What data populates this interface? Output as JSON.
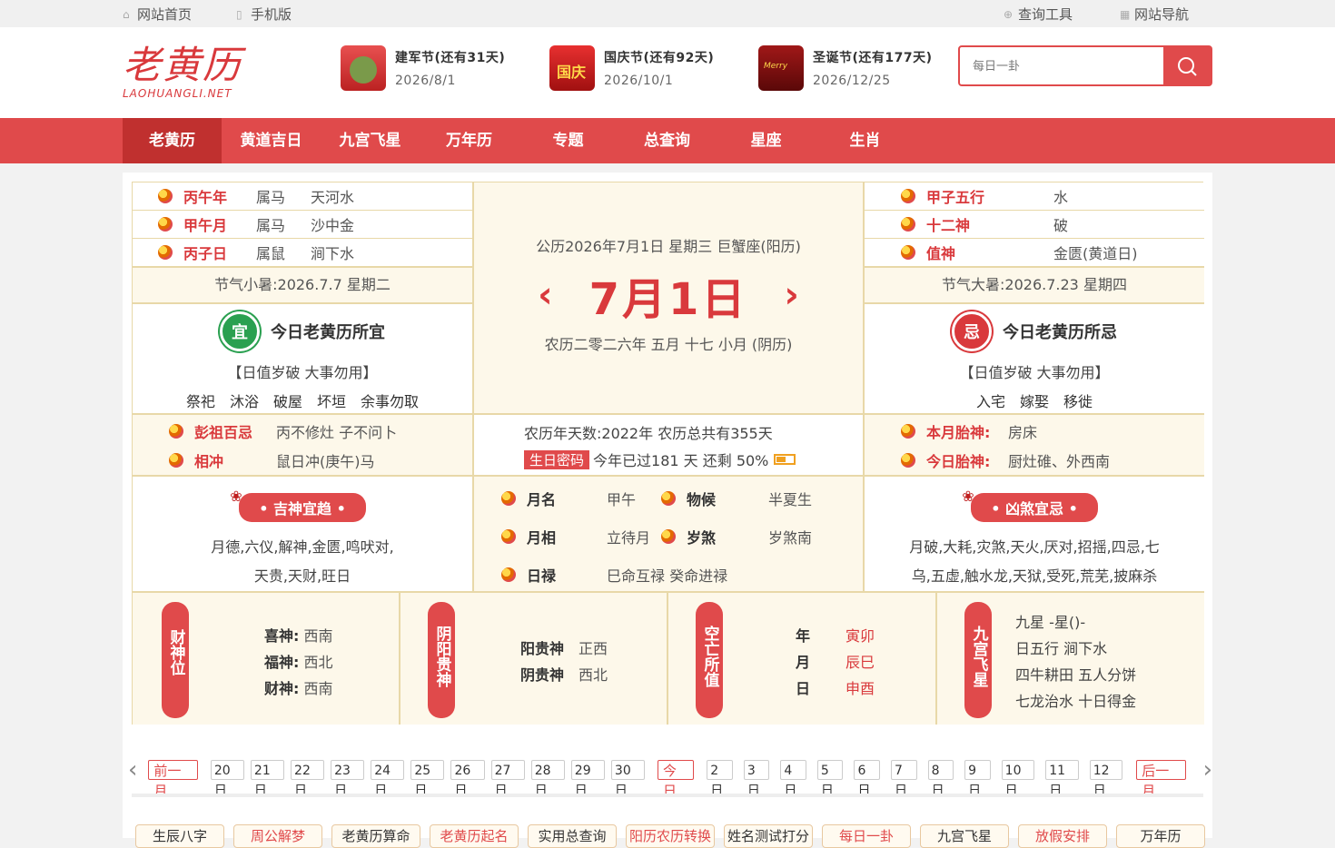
{
  "topbar": {
    "home": "网站首页",
    "mobile": "手机版",
    "tools": "查询工具",
    "nav": "网站导航"
  },
  "logo": {
    "cn": "老黄历",
    "en": "LAOHUANGLI.NET"
  },
  "festivals": [
    {
      "name": "建军节(还有31天)",
      "date": "2026/8/1"
    },
    {
      "name": "国庆节(还有92天)",
      "date": "2026/10/1"
    },
    {
      "name": "圣诞节(还有177天)",
      "date": "2026/12/25"
    }
  ],
  "search": {
    "placeholder": "每日一卦"
  },
  "nav": [
    "老黄历",
    "黄道吉日",
    "九宫飞星",
    "万年历",
    "专题",
    "总查询",
    "星座",
    "生肖"
  ],
  "left_rows": [
    {
      "k": "丙午年",
      "a": "属马",
      "b": "天河水"
    },
    {
      "k": "甲午月",
      "a": "属马",
      "b": "沙中金"
    },
    {
      "k": "丙子日",
      "a": "属鼠",
      "b": "涧下水"
    }
  ],
  "jieqi_left": "节气小暑:2026.7.7 星期二",
  "center": {
    "gongli": "公历2026年7月1日 星期三 巨蟹座(阳历)",
    "big": "7月1日",
    "nongli": "农历二零二六年 五月 十七 小月 (阴历)"
  },
  "right_rows": [
    {
      "k": "甲子五行",
      "v": "水"
    },
    {
      "k": "十二神",
      "v": "破"
    },
    {
      "k": "值神",
      "v": "金匮(黄道日)"
    }
  ],
  "jieqi_right": "节气大暑:2026.7.23 星期四",
  "yi": {
    "badge": "宜",
    "title": "今日老黄历所宜",
    "note": "【日值岁破 大事勿用】",
    "items": "祭祀　沐浴　破屋　坏垣　余事勿取"
  },
  "ji": {
    "badge": "忌",
    "title": "今日老黄历所忌",
    "note": "【日值岁破 大事勿用】",
    "items": "入宅　嫁娶　移徙"
  },
  "pengzu": {
    "k1": "彭祖百忌",
    "v1": "丙不修灶 子不问卜",
    "k2": "相冲",
    "v2": "鼠日冲(庚午)马"
  },
  "days": {
    "line1": "农历年天数:2022年 农历总共有355天",
    "tag": "生日密码",
    "line2": "今年已过181 天 还剩 50%"
  },
  "taishen": {
    "k1": "本月胎神:",
    "v1": "房床",
    "k2": "今日胎神:",
    "v2": "厨灶碓、外西南"
  },
  "jishen": {
    "ribbon": "吉神宜趋",
    "text1": "月德,六仪,解神,金匮,鸣吠对,",
    "text2": "天贵,天财,旺日"
  },
  "mid": {
    "k1": "月名",
    "v1": "甲午",
    "k2": "物候",
    "v2": "半夏生",
    "k3": "月相",
    "v3": "立待月",
    "k4": "岁煞",
    "v4": "岁煞南",
    "k5": "日禄",
    "v5": "巳命互禄 癸命进禄"
  },
  "xiongsha": {
    "ribbon": "凶煞宜忌",
    "text1": "月破,大耗,灾煞,天火,厌对,招摇,四忌,七",
    "text2": "乌,五虚,触水龙,天狱,受死,荒芜,披麻杀"
  },
  "caishen": {
    "tag": "财神位",
    "k1": "喜神:",
    "v1": "西南",
    "k2": "福神:",
    "v2": "西北",
    "k3": "财神:",
    "v3": "西南"
  },
  "guishen": {
    "tag": "阴阳贵神",
    "k1": "阳贵神",
    "v1": "正西",
    "k2": "阴贵神",
    "v2": "西北"
  },
  "kongwang": {
    "tag": "空亡所值",
    "k1": "年",
    "v1": "寅卯",
    "k2": "月",
    "v2": "辰巳",
    "k3": "日",
    "v3": "申酉"
  },
  "jiugong": {
    "tag": "九宫飞星",
    "l1": "九星 -星()-",
    "l2": "日五行 涧下水",
    "l3": "四牛耕田 五人分饼",
    "l4": "七龙治水 十日得金"
  },
  "calendar": {
    "prev": "前一月",
    "days_a": [
      "20日",
      "21日",
      "22日",
      "23日",
      "24日",
      "25日",
      "26日",
      "27日",
      "28日",
      "29日",
      "30日"
    ],
    "today": "今日",
    "days_b": [
      "2日",
      "3日",
      "4日",
      "5日",
      "6日",
      "7日",
      "8日",
      "9日",
      "10日",
      "11日",
      "12日"
    ],
    "next": "后一月"
  },
  "bottom": [
    "生辰八字",
    "周公解梦",
    "老黄历算命",
    "老黄历起名",
    "实用总查询",
    "阳历农历转换",
    "姓名测试打分",
    "每日一卦",
    "九宫飞星",
    "放假安排",
    "万年历"
  ],
  "colors": {
    "accent": "#e04a4b",
    "frame": "#e8d8a8",
    "cream": "#fdf8ea"
  }
}
